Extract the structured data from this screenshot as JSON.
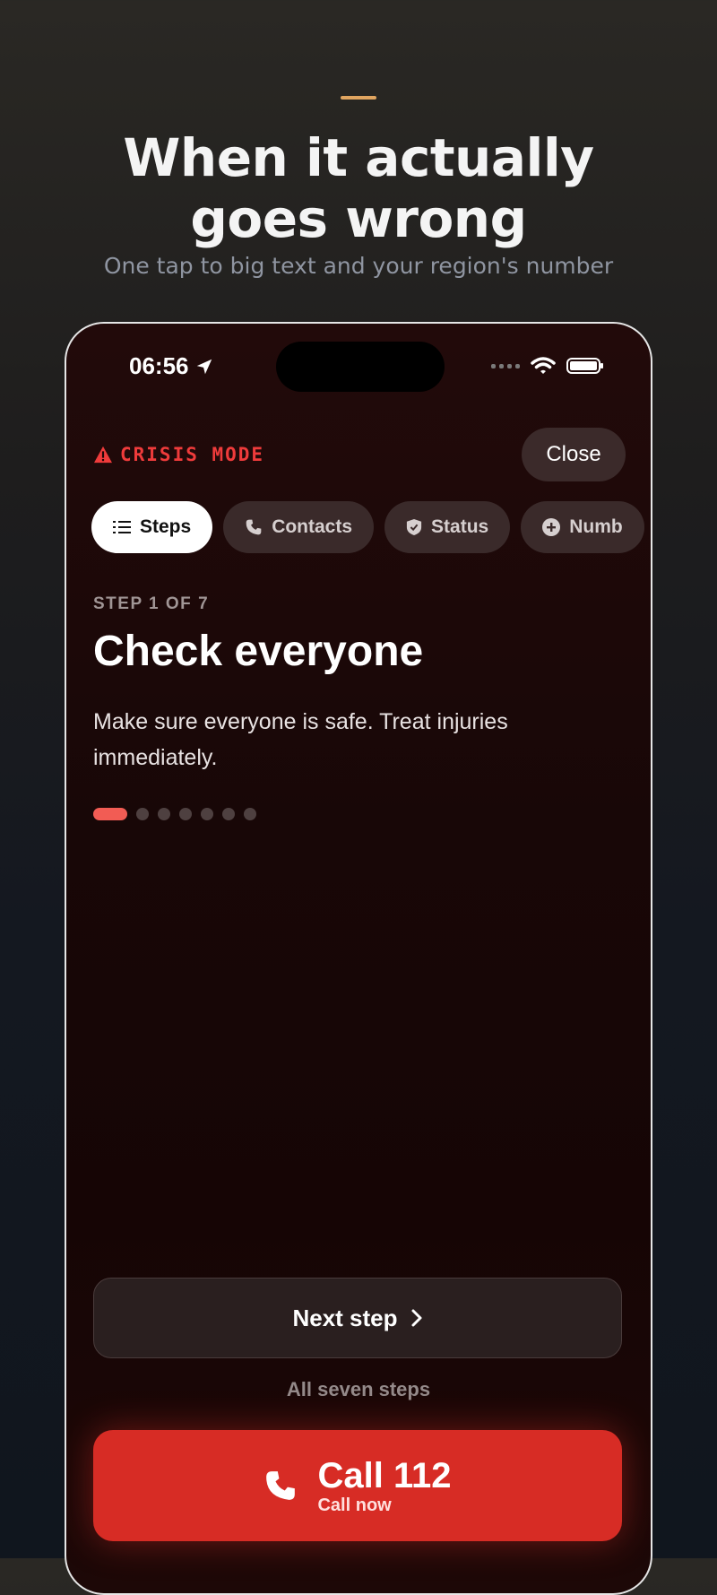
{
  "page": {
    "headline": "When it actually goes wrong",
    "subtitle": "One tap to big text and your region's number"
  },
  "status_bar": {
    "time": "06:56"
  },
  "crisis": {
    "label": "CRISIS MODE",
    "close_label": "Close"
  },
  "tabs": [
    {
      "label": "Steps",
      "icon": "list-icon",
      "active": true
    },
    {
      "label": "Contacts",
      "icon": "phone-icon",
      "active": false
    },
    {
      "label": "Status",
      "icon": "shield-icon",
      "active": false
    },
    {
      "label": "Numb",
      "icon": "plus-circle-icon",
      "active": false
    }
  ],
  "step": {
    "counter": "STEP 1 OF 7",
    "title": "Check everyone",
    "body": "Make sure everyone is safe. Treat injuries immediately.",
    "current": 1,
    "total": 7
  },
  "actions": {
    "next_label": "Next step",
    "all_steps_label": "All seven steps",
    "call_label": "Call 112",
    "call_sublabel": "Call now"
  },
  "colors": {
    "accent": "#e0a560",
    "crisis_red": "#ef3b3b",
    "call_button": "#d72c25",
    "active_dot": "#f25c54"
  }
}
